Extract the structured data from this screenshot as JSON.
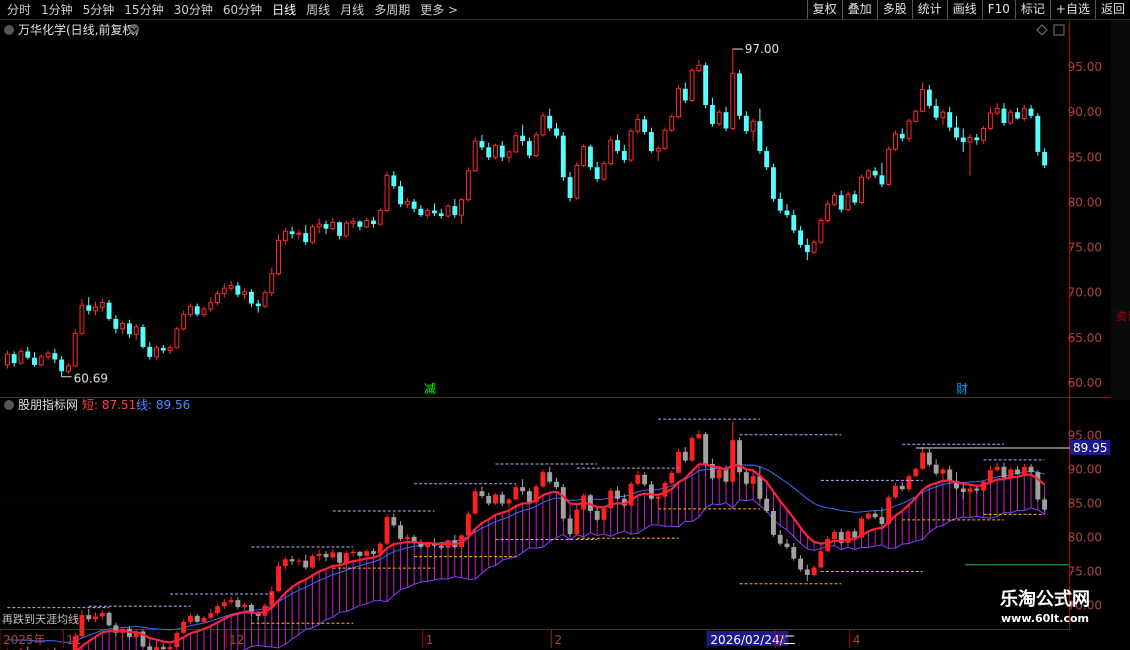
{
  "toolbar": {
    "tabs": [
      "分时",
      "1分钟",
      "5分钟",
      "15分钟",
      "30分钟",
      "60分钟",
      "日线",
      "周线",
      "月线",
      "多周期",
      "更多 >"
    ],
    "active_tab": "日线",
    "right_buttons": [
      "复权",
      "叠加",
      "多股",
      "统计",
      "画线",
      "F10",
      "标记",
      "+自选",
      "返回"
    ]
  },
  "main_panel": {
    "title": "万华化学(日线,前复权)",
    "high_label": "97.00",
    "low_label": "60.69",
    "y_ticks": [
      "95.00",
      "90.00",
      "85.00",
      "80.00",
      "75.00",
      "70.00",
      "65.00",
      "60.00"
    ],
    "event_markers": [
      {
        "text": "减",
        "color": "#00ff00"
      },
      {
        "text": "财",
        "color": "#00a0ff"
      }
    ]
  },
  "indicator_panel": {
    "name": "股朋指标网",
    "short_label": "短: 87.51",
    "line_label": "线: 89.56",
    "value_badge": "89.95",
    "y_ticks": [
      "95.00",
      "90.00",
      "85.00",
      "80.00",
      "75.00",
      "70.00"
    ],
    "bottom_note": "再跌到天涯均线"
  },
  "x_axis": {
    "labels": [
      "2025年",
      "11",
      "12",
      "1",
      "2",
      "2026/02/24/二",
      "3",
      "4"
    ]
  },
  "right_strip_text": "资讯",
  "watermark": {
    "line1": "乐淘公式网",
    "line2": "www.60lt.com"
  },
  "chart_data": {
    "type": "candlestick",
    "title": "万华化学(日线,前复权)",
    "ylim": [
      59,
      98
    ],
    "ohlc": [
      [
        62,
        63.6,
        61.6,
        63.2
      ],
      [
        63.2,
        63.5,
        61.8,
        62.2
      ],
      [
        62.2,
        63.8,
        62,
        63.5
      ],
      [
        63.5,
        64,
        62.6,
        62.8
      ],
      [
        62.8,
        63.4,
        61.8,
        62
      ],
      [
        62,
        63.2,
        61.8,
        62.9
      ],
      [
        62.9,
        63.6,
        62.5,
        63.3
      ],
      [
        63.3,
        63.8,
        62.2,
        62.6
      ],
      [
        62.6,
        63,
        60.69,
        61.3
      ],
      [
        61.3,
        62.2,
        61,
        61.9
      ],
      [
        61.9,
        66,
        61.8,
        65.5
      ],
      [
        65.5,
        69.3,
        65.3,
        68.6
      ],
      [
        68.6,
        69.5,
        67.6,
        68
      ],
      [
        68,
        69,
        67.5,
        68.4
      ],
      [
        68.4,
        69.3,
        67.9,
        68.9
      ],
      [
        68.9,
        69.2,
        66.9,
        67.1
      ],
      [
        67.1,
        67.5,
        65.5,
        66
      ],
      [
        66,
        66.8,
        65.4,
        66.6
      ],
      [
        66.6,
        67,
        65,
        65.4
      ],
      [
        65.4,
        66.5,
        64.8,
        66.2
      ],
      [
        66.2,
        66.5,
        63.8,
        64
      ],
      [
        64,
        64.5,
        62.6,
        62.9
      ],
      [
        62.9,
        64.2,
        62.6,
        63.9
      ],
      [
        63.9,
        64.2,
        63.3,
        63.6
      ],
      [
        63.6,
        64.2,
        63.2,
        63.9
      ],
      [
        63.9,
        66.2,
        63.8,
        66
      ],
      [
        66,
        68,
        65.8,
        67.6
      ],
      [
        67.6,
        68.8,
        67.3,
        68.5
      ],
      [
        68.5,
        68.8,
        67.4,
        67.6
      ],
      [
        67.6,
        68.5,
        67.3,
        68.2
      ],
      [
        68.2,
        69.5,
        67.9,
        68.9
      ],
      [
        68.9,
        70.2,
        68.6,
        69.9
      ],
      [
        69.9,
        71,
        69.5,
        70.5
      ],
      [
        70.5,
        71.3,
        70.2,
        70.8
      ],
      [
        70.8,
        71.2,
        69.5,
        69.8
      ],
      [
        69.8,
        70.5,
        69.3,
        70.1
      ],
      [
        70.1,
        70.4,
        68.4,
        68.8
      ],
      [
        68.8,
        69.2,
        67.8,
        68.5
      ],
      [
        68.5,
        70.3,
        68.3,
        70
      ],
      [
        70,
        72.8,
        69.6,
        72.1
      ],
      [
        72.1,
        76.5,
        71.9,
        75.8
      ],
      [
        75.8,
        77.2,
        75.3,
        76.8
      ],
      [
        76.8,
        77.3,
        76,
        76.5
      ],
      [
        76.5,
        77,
        75.9,
        76.6
      ],
      [
        76.6,
        77.5,
        75.3,
        75.6
      ],
      [
        75.6,
        77.6,
        75.4,
        77.3
      ],
      [
        77.3,
        78.2,
        76.6,
        77.6
      ],
      [
        77.6,
        78,
        76.5,
        77.1
      ],
      [
        77.1,
        78.3,
        76.9,
        77.8
      ],
      [
        77.8,
        77.9,
        75.9,
        76.3
      ],
      [
        76.3,
        78,
        76.1,
        77.7
      ],
      [
        77.7,
        78.3,
        77.2,
        77.9
      ],
      [
        77.9,
        78,
        76.9,
        77.3
      ],
      [
        77.3,
        78.3,
        77.1,
        78
      ],
      [
        78,
        78.4,
        77.2,
        77.6
      ],
      [
        77.6,
        79.4,
        77.4,
        79.1
      ],
      [
        79.1,
        83.4,
        78.9,
        83
      ],
      [
        83,
        83.5,
        81.5,
        81.8
      ],
      [
        81.8,
        82.4,
        79.5,
        79.8
      ],
      [
        79.8,
        80.5,
        79.4,
        80.1
      ],
      [
        80.1,
        80.4,
        78.9,
        79.3
      ],
      [
        79.3,
        79.7,
        78.4,
        78.6
      ],
      [
        78.6,
        79.4,
        78.2,
        79.1
      ],
      [
        79.1,
        79.9,
        78.5,
        78.8
      ],
      [
        78.8,
        79.3,
        78.2,
        78.5
      ],
      [
        78.5,
        79.8,
        78.3,
        79.6
      ],
      [
        79.6,
        80.4,
        78.3,
        78.6
      ],
      [
        78.6,
        80.5,
        77.6,
        80.3
      ],
      [
        80.3,
        83.9,
        80.1,
        83.5
      ],
      [
        83.5,
        87.2,
        83.4,
        86.8
      ],
      [
        86.8,
        87.5,
        85.8,
        86.1
      ],
      [
        86.1,
        86.6,
        84.7,
        85
      ],
      [
        85,
        86.5,
        84.8,
        86.3
      ],
      [
        86.3,
        86.8,
        84.6,
        85
      ],
      [
        85,
        85.8,
        84.4,
        85.6
      ],
      [
        85.6,
        87.8,
        85.5,
        87.4
      ],
      [
        87.4,
        88.6,
        86.3,
        86.8
      ],
      [
        86.8,
        87.2,
        84.9,
        85.2
      ],
      [
        85.2,
        87.8,
        85,
        87.5
      ],
      [
        87.5,
        90,
        87.3,
        89.6
      ],
      [
        89.6,
        90.4,
        87.9,
        88.2
      ],
      [
        88.2,
        88.8,
        87.1,
        87.4
      ],
      [
        87.4,
        87.8,
        82.4,
        82.8
      ],
      [
        82.8,
        83.4,
        80.1,
        80.5
      ],
      [
        80.5,
        84.5,
        80.3,
        84.1
      ],
      [
        84.1,
        86.5,
        83.9,
        86.2
      ],
      [
        86.2,
        86.4,
        83.6,
        83.9
      ],
      [
        83.9,
        84.5,
        82.3,
        82.6
      ],
      [
        82.6,
        84.6,
        82.4,
        84.3
      ],
      [
        84.3,
        87.3,
        84.1,
        86.9
      ],
      [
        86.9,
        87.5,
        85.4,
        85.7
      ],
      [
        85.7,
        86.4,
        84.4,
        84.7
      ],
      [
        84.7,
        88.2,
        84.5,
        87.9
      ],
      [
        87.9,
        89.8,
        87.6,
        89.2
      ],
      [
        89.2,
        89.6,
        87.5,
        87.8
      ],
      [
        87.8,
        88.3,
        85.5,
        85.7
      ],
      [
        85.7,
        86.3,
        84.6,
        86
      ],
      [
        86,
        88.3,
        85.8,
        88
      ],
      [
        88,
        89.8,
        87.8,
        89.5
      ],
      [
        89.5,
        93,
        89.3,
        92.6
      ],
      [
        92.6,
        93.3,
        91,
        91.3
      ],
      [
        91.3,
        94.9,
        91.1,
        94.6
      ],
      [
        94.6,
        95.8,
        94.4,
        95.2
      ],
      [
        95.2,
        95.5,
        90.4,
        90.8
      ],
      [
        90.8,
        91.6,
        88.4,
        88.7
      ],
      [
        88.7,
        90.3,
        88.5,
        90
      ],
      [
        90,
        90.6,
        87.9,
        88.2
      ],
      [
        88.2,
        97,
        88,
        94.3
      ],
      [
        94.3,
        94.7,
        89.2,
        89.6
      ],
      [
        89.6,
        90.1,
        87.6,
        87.9
      ],
      [
        87.9,
        89.3,
        86.8,
        89
      ],
      [
        89,
        90.4,
        85.4,
        85.7
      ],
      [
        85.7,
        86.2,
        83.6,
        83.9
      ],
      [
        83.9,
        84.3,
        80.1,
        80.4
      ],
      [
        80.4,
        81.1,
        78.8,
        79.1
      ],
      [
        79.1,
        79.8,
        78.3,
        78.6
      ],
      [
        78.6,
        79.2,
        76.6,
        76.9
      ],
      [
        76.9,
        77.4,
        75,
        75.3
      ],
      [
        75.3,
        76,
        73.6,
        74.5
      ],
      [
        74.5,
        75.9,
        74.3,
        75.6
      ],
      [
        75.6,
        78.3,
        75.4,
        78
      ],
      [
        78,
        80.2,
        77.8,
        79.8
      ],
      [
        79.8,
        81.1,
        79.6,
        80.8
      ],
      [
        80.8,
        81.3,
        78.9,
        79.2
      ],
      [
        79.2,
        81.2,
        79,
        80.9
      ],
      [
        80.9,
        81.3,
        79.7,
        80
      ],
      [
        80,
        83.1,
        79.8,
        82.8
      ],
      [
        82.8,
        83.7,
        82.5,
        83.5
      ],
      [
        83.5,
        83.9,
        82.7,
        83
      ],
      [
        83,
        84.4,
        81.7,
        82
      ],
      [
        82,
        86.2,
        81.8,
        85.9
      ],
      [
        85.9,
        88,
        85.7,
        87.6
      ],
      [
        87.6,
        88.2,
        86.8,
        87.1
      ],
      [
        87.1,
        89.3,
        86.7,
        89
      ],
      [
        89,
        90.3,
        88.9,
        90.1
      ],
      [
        90.1,
        93.3,
        90,
        92.5
      ],
      [
        92.5,
        93,
        90.4,
        90.7
      ],
      [
        90.7,
        91.5,
        89.1,
        89.4
      ],
      [
        89.4,
        90.3,
        88.6,
        90
      ],
      [
        90,
        90.6,
        87.9,
        88.3
      ],
      [
        88.3,
        89.6,
        86.9,
        87.2
      ],
      [
        87.2,
        88.2,
        85.6,
        86.7
      ],
      [
        86.7,
        87.6,
        83,
        87.2
      ],
      [
        87.2,
        87.6,
        86.4,
        86.9
      ],
      [
        86.9,
        88.5,
        86.5,
        88.2
      ],
      [
        88.2,
        90.6,
        88,
        89.9
      ],
      [
        89.9,
        91,
        89.7,
        90.4
      ],
      [
        90.4,
        91,
        88.5,
        88.8
      ],
      [
        88.8,
        90.3,
        88.6,
        90
      ],
      [
        90,
        90.5,
        89.2,
        89.3
      ],
      [
        89.3,
        90.8,
        89,
        90.4
      ],
      [
        90.4,
        90.8,
        89.3,
        89.6
      ],
      [
        89.6,
        89.9,
        85.2,
        85.6
      ],
      [
        85.6,
        86,
        83.8,
        84.1
      ]
    ],
    "indicator": {
      "short_label": "短",
      "short_last": 87.51,
      "line_label": "线",
      "line_last": 89.56
    }
  }
}
